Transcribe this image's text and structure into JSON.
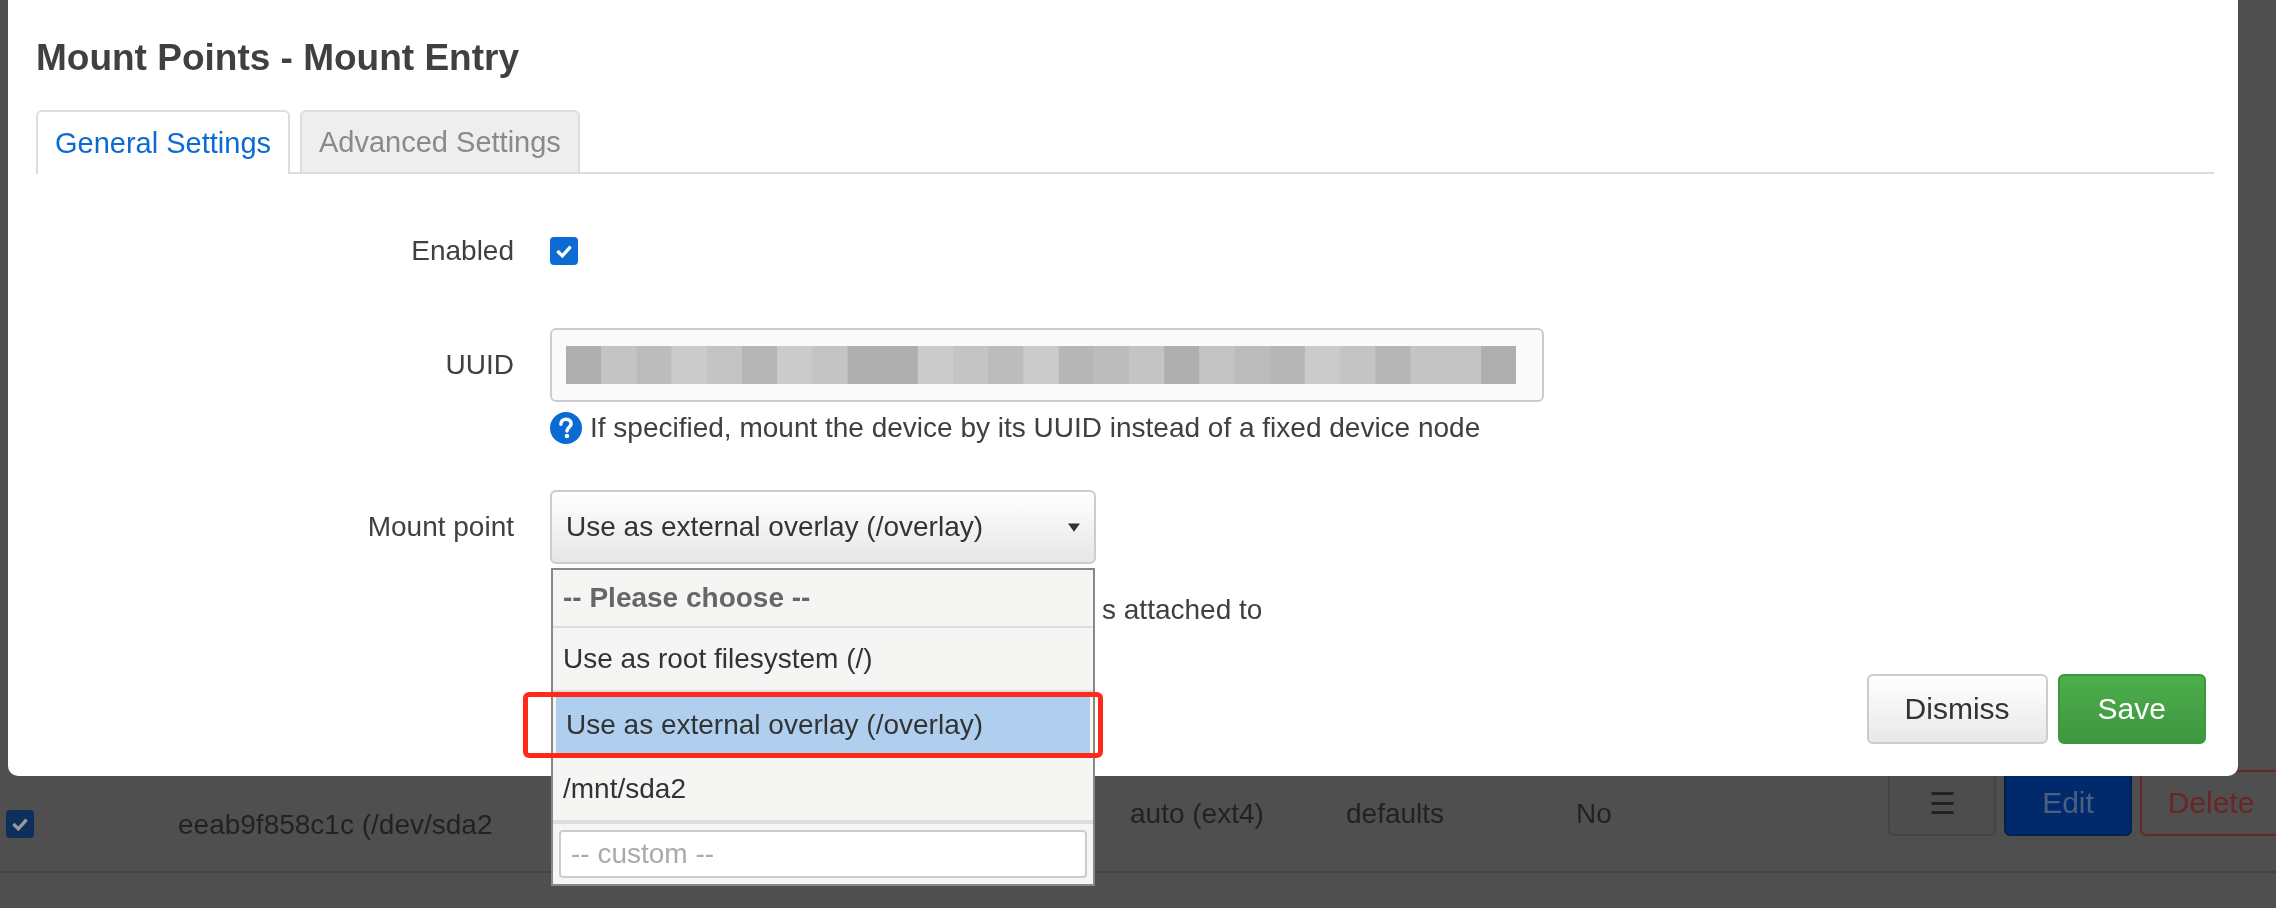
{
  "dialog": {
    "title": "Mount Points - Mount Entry",
    "tabs": [
      {
        "label": "General Settings",
        "selected": true
      },
      {
        "label": "Advanced Settings",
        "selected": false
      }
    ],
    "fields": [
      {
        "kind": "checkbox",
        "label": "Enabled",
        "checked": true
      },
      {
        "kind": "text",
        "label": "UUID",
        "help": "If specified, mount the device by its UUID instead of a fixed device node"
      },
      {
        "kind": "select",
        "label": "Mount point",
        "value": "Use as external overlay (/overlay)",
        "help": "s attached to"
      }
    ],
    "dropdown": {
      "options": [
        {
          "kind": "header",
          "label": "-- Please choose --",
          "selected": false
        },
        {
          "kind": "option",
          "label": "Use as root filesystem (/)",
          "selected": false
        },
        {
          "kind": "option",
          "label": "Use as external overlay (/overlay)",
          "selected": true
        },
        {
          "kind": "option",
          "label": "/mnt/sda2",
          "selected": false
        },
        {
          "kind": "custom",
          "placeholder": "-- custom --"
        }
      ]
    },
    "buttons": [
      {
        "kind": "default",
        "label": "Dismiss"
      },
      {
        "kind": "primary",
        "label": "Save"
      }
    ]
  },
  "background_row": {
    "checked": true,
    "device": "eeab9f858c1c (/dev/sda2",
    "filesystem": "auto (ext4)",
    "options": "defaults",
    "column_4": "No",
    "buttons": [
      {
        "kind": "menu",
        "label": "☰"
      },
      {
        "kind": "edit",
        "label": "Edit"
      },
      {
        "kind": "delete",
        "label": "Delete"
      }
    ]
  }
}
